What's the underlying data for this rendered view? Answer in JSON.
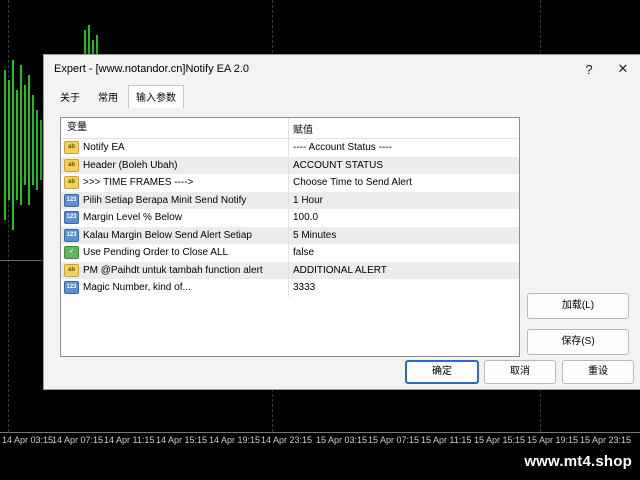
{
  "dialog": {
    "title": "Expert - [www.notandor.cn]Notify EA 2.0",
    "help": "?",
    "close": "✕"
  },
  "tabs": [
    {
      "label": "关于"
    },
    {
      "label": "常用"
    },
    {
      "label": "输入参数"
    }
  ],
  "table": {
    "col_variable": "变量",
    "col_value": "赋值",
    "rows": [
      {
        "icon": "ab",
        "name": "Notify EA",
        "value": "---- Account Status ----"
      },
      {
        "icon": "ab",
        "name": "Header (Boleh Ubah)",
        "value": "ACCOUNT STATUS"
      },
      {
        "icon": "ab",
        "name": ">>> TIME FRAMES ---->",
        "value": "Choose Time to Send Alert"
      },
      {
        "icon": "123",
        "name": "Pilih Setiap Berapa Minit Send Notify",
        "value": "1 Hour"
      },
      {
        "icon": "123",
        "name": "Margin Level % Below",
        "value": "100.0"
      },
      {
        "icon": "123",
        "name": "Kalau Margin Below Send Alert Setiap",
        "value": "5 Minutes"
      },
      {
        "icon": "bool",
        "name": "Use Pending Order to Close ALL",
        "value": "false"
      },
      {
        "icon": "ab",
        "name": "PM @Paihdt untuk tambah function alert",
        "value": "ADDITIONAL ALERT"
      },
      {
        "icon": "123",
        "name": "Magic Number, kind of...",
        "value": "3333"
      }
    ]
  },
  "buttons": {
    "load": "加载(L)",
    "save": "保存(S)",
    "ok": "确定",
    "cancel": "取消",
    "reset": "重设"
  },
  "time_axis": [
    "14 Apr 03:15",
    "14 Apr 07:15",
    "14 Apr 11:15",
    "14 Apr 15:15",
    "14 Apr 19:15",
    "14 Apr 23:15",
    "15 Apr 03:15",
    "15 Apr 07:15",
    "15 Apr 11:15",
    "15 Apr 15:15",
    "15 Apr 19:15",
    "15 Apr 23:15"
  ],
  "watermark": "www.mt4.shop",
  "colors": {
    "candle": "#22c022",
    "accent": "#2f68c4",
    "background": "#000000"
  }
}
